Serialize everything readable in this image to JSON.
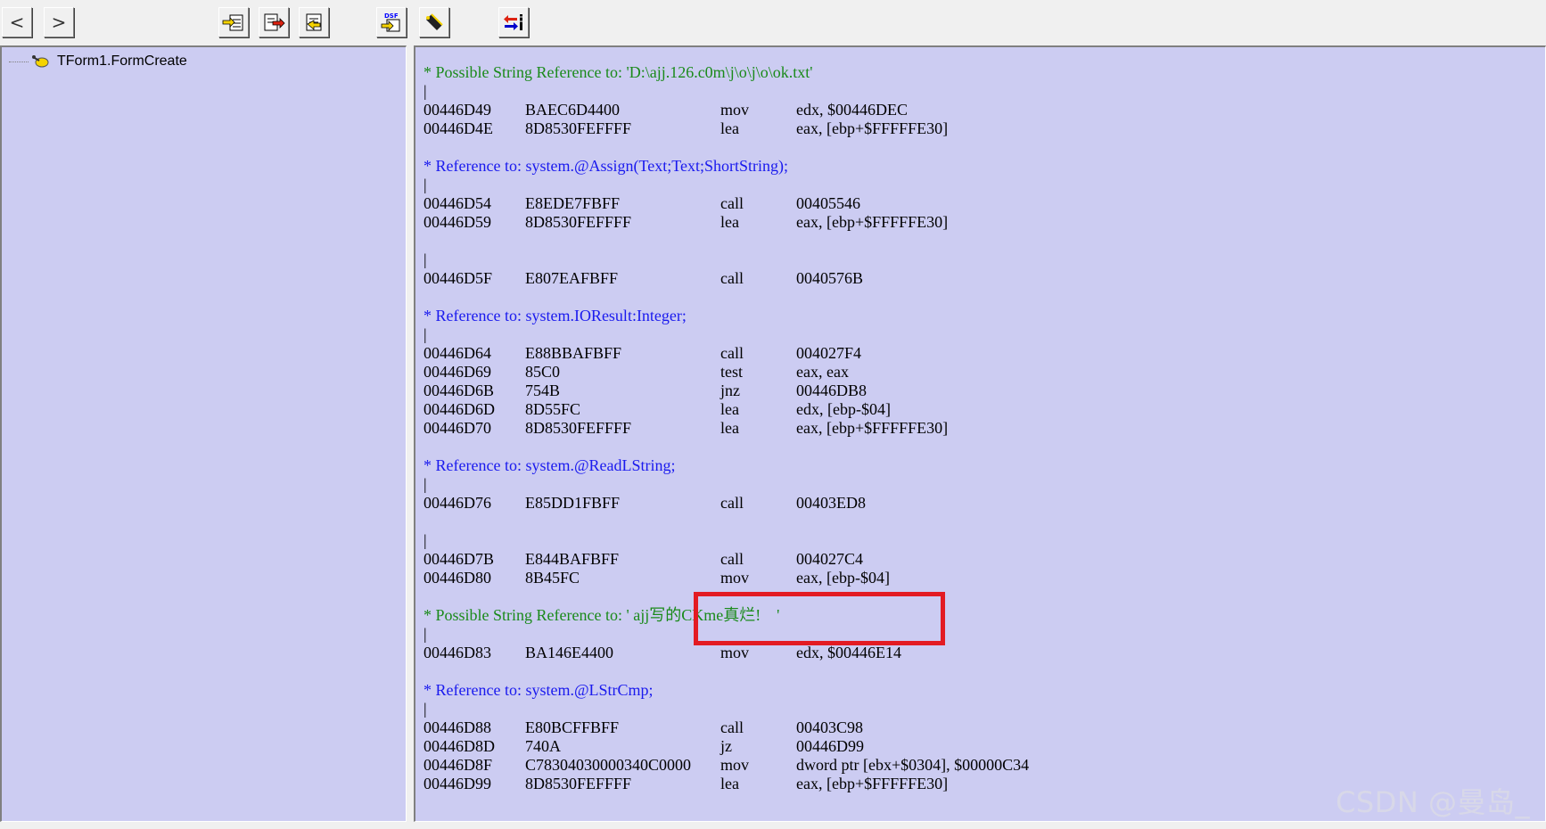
{
  "toolbar": {
    "nav_back": "<",
    "nav_forward": ">"
  },
  "tree": {
    "item_label": "TForm1.FormCreate"
  },
  "code_lines": [
    {
      "kind": "str",
      "text": "* Possible String Reference to: 'D:\\ajj.126.c0m\\j\\o\\j\\o\\ok.txt'"
    },
    {
      "kind": "bar",
      "text": "|"
    },
    {
      "kind": "ins",
      "addr": "00446D49",
      "bytes": "BAEC6D4400",
      "mnem": "mov",
      "oper": "edx, $00446DEC"
    },
    {
      "kind": "ins",
      "addr": "00446D4E",
      "bytes": "8D8530FEFFFF",
      "mnem": "lea",
      "oper": "eax, [ebp+$FFFFFE30]"
    },
    {
      "kind": "blank"
    },
    {
      "kind": "fn",
      "text": "* Reference to: system.@Assign(Text;Text;ShortString);"
    },
    {
      "kind": "bar",
      "text": "|"
    },
    {
      "kind": "ins",
      "addr": "00446D54",
      "bytes": "E8EDE7FBFF",
      "mnem": "call",
      "oper": "00405546"
    },
    {
      "kind": "ins",
      "addr": "00446D59",
      "bytes": "8D8530FEFFFF",
      "mnem": "lea",
      "oper": "eax, [ebp+$FFFFFE30]"
    },
    {
      "kind": "blank"
    },
    {
      "kind": "bar",
      "text": "|"
    },
    {
      "kind": "ins",
      "addr": "00446D5F",
      "bytes": "E807EAFBFF",
      "mnem": "call",
      "oper": "0040576B"
    },
    {
      "kind": "blank"
    },
    {
      "kind": "fn",
      "text": "* Reference to: system.IOResult:Integer;"
    },
    {
      "kind": "bar",
      "text": "|"
    },
    {
      "kind": "ins",
      "addr": "00446D64",
      "bytes": "E88BBAFBFF",
      "mnem": "call",
      "oper": "004027F4"
    },
    {
      "kind": "ins",
      "addr": "00446D69",
      "bytes": "85C0",
      "mnem": "test",
      "oper": "eax, eax"
    },
    {
      "kind": "ins",
      "addr": "00446D6B",
      "bytes": "754B",
      "mnem": "jnz",
      "oper": "00446DB8"
    },
    {
      "kind": "ins",
      "addr": "00446D6D",
      "bytes": "8D55FC",
      "mnem": "lea",
      "oper": "edx, [ebp-$04]"
    },
    {
      "kind": "ins",
      "addr": "00446D70",
      "bytes": "8D8530FEFFFF",
      "mnem": "lea",
      "oper": "eax, [ebp+$FFFFFE30]"
    },
    {
      "kind": "blank"
    },
    {
      "kind": "fn",
      "text": "* Reference to: system.@ReadLString;"
    },
    {
      "kind": "bar",
      "text": "|"
    },
    {
      "kind": "ins",
      "addr": "00446D76",
      "bytes": "E85DD1FBFF",
      "mnem": "call",
      "oper": "00403ED8"
    },
    {
      "kind": "blank"
    },
    {
      "kind": "bar",
      "text": "|"
    },
    {
      "kind": "ins",
      "addr": "00446D7B",
      "bytes": "E844BAFBFF",
      "mnem": "call",
      "oper": "004027C4"
    },
    {
      "kind": "ins",
      "addr": "00446D80",
      "bytes": "8B45FC",
      "mnem": "mov",
      "oper": "eax, [ebp-$04]"
    },
    {
      "kind": "blank"
    },
    {
      "kind": "str",
      "text": "* Possible String Reference to: ' ajj写的CKme真烂!    '"
    },
    {
      "kind": "bar",
      "text": "|"
    },
    {
      "kind": "ins",
      "addr": "00446D83",
      "bytes": "BA146E4400",
      "mnem": "mov",
      "oper": "edx, $00446E14"
    },
    {
      "kind": "blank"
    },
    {
      "kind": "fn",
      "text": "* Reference to: system.@LStrCmp;"
    },
    {
      "kind": "bar",
      "text": "|"
    },
    {
      "kind": "ins",
      "addr": "00446D88",
      "bytes": "E80BCFFBFF",
      "mnem": "call",
      "oper": "00403C98"
    },
    {
      "kind": "ins",
      "addr": "00446D8D",
      "bytes": "740A",
      "mnem": "jz",
      "oper": "00446D99"
    },
    {
      "kind": "ins",
      "addr": "00446D8F",
      "bytes": "C78304030000340C0000",
      "mnem": "mov",
      "oper": "dword ptr [ebx+$0304], $00000C34"
    },
    {
      "kind": "ins",
      "addr": "00446D99",
      "bytes": "8D8530FEFFFF",
      "mnem": "lea",
      "oper": "eax, [ebp+$FFFFFE30]"
    }
  ],
  "watermark": "CSDN @曼岛_",
  "colors": {
    "panel_bg": "#ccccf2",
    "string_ref": "#1a8a1a",
    "function_ref": "#1a1aee",
    "highlight": "#e31b23"
  }
}
